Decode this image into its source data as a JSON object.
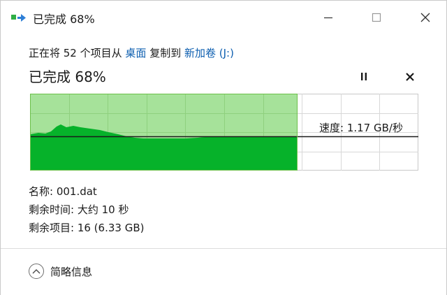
{
  "window": {
    "title": "已完成 68%",
    "icon": "copy-transfer-icon",
    "controls": [
      "minimize-icon",
      "maximize-icon",
      "close-icon"
    ]
  },
  "transfer": {
    "prefix": "正在将 52 个项目从",
    "source": "桌面",
    "middle": "复制到",
    "destination": "新加卷 (J:)",
    "progress_label": "已完成 68%",
    "progress_percent": 68,
    "speed_label": "速度: 1.17 GB/秒"
  },
  "details": {
    "name": "名称: 001.dat",
    "time_remaining": "剩余时间: 大约 10 秒",
    "items_remaining": "剩余项目: 16 (6.33 GB)"
  },
  "footer": {
    "toggle_label": "简略信息"
  },
  "colors": {
    "link": "#0e5fb0",
    "graph_fill_light": "#a6e29a",
    "graph_fill_dark": "#06b22a",
    "graph_grid": "#d6d6d6",
    "graph_border": "#6cc04a"
  }
}
